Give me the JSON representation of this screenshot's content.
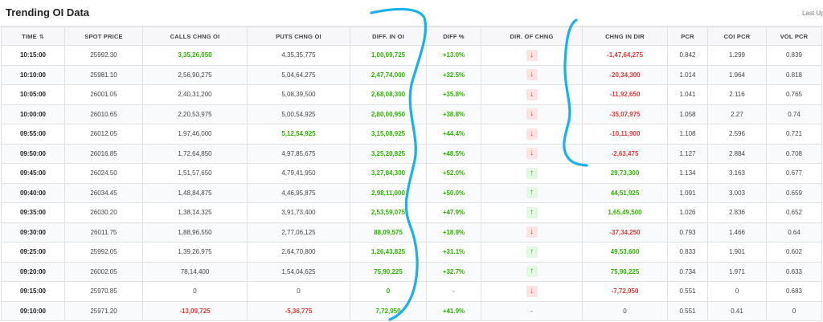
{
  "header": {
    "title": "Trending OI Data",
    "last_updated": "Last Upd"
  },
  "table": {
    "columns": [
      "TIME",
      "SPOT PRICE",
      "CALLS CHNG OI",
      "PUTS CHNG OI",
      "DIFF. IN OI",
      "DIFF %",
      "DIR. OF CHNG",
      "CHNG IN DIR",
      "PCR",
      "COI PCR",
      "VOL PCR"
    ],
    "sort_icon": "⇅",
    "rows": [
      {
        "time": "10:15:00",
        "spot": "25992.30",
        "calls": "3,35,26,050",
        "calls_color": "green",
        "puts": "4,35,35,775",
        "puts_color": "grey",
        "diff": "1,00,09,725",
        "diff_pct": "+13.0%",
        "dir": "down",
        "chng": "-1,47,64,275",
        "chng_color": "red",
        "pcr": "0.842",
        "coi": "1.299",
        "vol": "0.839"
      },
      {
        "time": "10:10:00",
        "spot": "25981.10",
        "calls": "2,56,90,275",
        "calls_color": "grey",
        "puts": "5,04,64,275",
        "puts_color": "grey",
        "diff": "2,47,74,000",
        "diff_pct": "+32.5%",
        "dir": "down",
        "chng": "-20,34,300",
        "chng_color": "red",
        "pcr": "1.014",
        "coi": "1.964",
        "vol": "0.818"
      },
      {
        "time": "10:05:00",
        "spot": "26001.05",
        "calls": "2,40,31,200",
        "calls_color": "grey",
        "puts": "5,08,39,500",
        "puts_color": "grey",
        "diff": "2,68,08,300",
        "diff_pct": "+35.8%",
        "dir": "down",
        "chng": "-11,92,650",
        "chng_color": "red",
        "pcr": "1.041",
        "coi": "2.116",
        "vol": "0.765"
      },
      {
        "time": "10:00:00",
        "spot": "26010.65",
        "calls": "2,20,53,975",
        "calls_color": "grey",
        "puts": "5,00,54,925",
        "puts_color": "grey",
        "diff": "2,80,00,950",
        "diff_pct": "+38.8%",
        "dir": "down",
        "chng": "-35,07,975",
        "chng_color": "red",
        "pcr": "1.058",
        "coi": "2.27",
        "vol": "0.74"
      },
      {
        "time": "09:55:00",
        "spot": "26012.05",
        "calls": "1,97,46,000",
        "calls_color": "grey",
        "puts": "5,12,54,925",
        "puts_color": "green",
        "diff": "3,15,08,925",
        "diff_pct": "+44.4%",
        "dir": "down",
        "chng": "-10,11,900",
        "chng_color": "red",
        "pcr": "1.108",
        "coi": "2.596",
        "vol": "0.721"
      },
      {
        "time": "09:50:00",
        "spot": "26016.85",
        "calls": "1,72,64,850",
        "calls_color": "grey",
        "puts": "4,97,85,675",
        "puts_color": "grey",
        "diff": "3,25,20,825",
        "diff_pct": "+48.5%",
        "dir": "down",
        "chng": "-2,63,475",
        "chng_color": "red",
        "pcr": "1.127",
        "coi": "2.884",
        "vol": "0.708"
      },
      {
        "time": "09:45:00",
        "spot": "26024.50",
        "calls": "1,51,57,650",
        "calls_color": "grey",
        "puts": "4,79,41,950",
        "puts_color": "grey",
        "diff": "3,27,84,300",
        "diff_pct": "+52.0%",
        "dir": "up",
        "chng": "29,73,300",
        "chng_color": "green",
        "pcr": "1.134",
        "coi": "3.163",
        "vol": "0.677"
      },
      {
        "time": "09:40:00",
        "spot": "26034.45",
        "calls": "1,48,84,875",
        "calls_color": "grey",
        "puts": "4,46,95,875",
        "puts_color": "grey",
        "diff": "2,98,11,000",
        "diff_pct": "+50.0%",
        "dir": "up",
        "chng": "44,51,925",
        "chng_color": "green",
        "pcr": "1.091",
        "coi": "3.003",
        "vol": "0.659"
      },
      {
        "time": "09:35:00",
        "spot": "26030.20",
        "calls": "1,38,14,325",
        "calls_color": "grey",
        "puts": "3,91,73,400",
        "puts_color": "grey",
        "diff": "2,53,59,075",
        "diff_pct": "+47.9%",
        "dir": "up",
        "chng": "1,65,49,500",
        "chng_color": "green",
        "pcr": "1.026",
        "coi": "2.836",
        "vol": "0.652"
      },
      {
        "time": "09:30:00",
        "spot": "26011.75",
        "calls": "1,88,96,550",
        "calls_color": "grey",
        "puts": "2,77,06,125",
        "puts_color": "grey",
        "diff": "88,09,575",
        "diff_pct": "+18.9%",
        "dir": "down",
        "chng": "-37,34,250",
        "chng_color": "red",
        "pcr": "0.793",
        "coi": "1.466",
        "vol": "0.64"
      },
      {
        "time": "09:25:00",
        "spot": "25992.05",
        "calls": "1,39,26,975",
        "calls_color": "grey",
        "puts": "2,64,70,800",
        "puts_color": "grey",
        "diff": "1,26,43,825",
        "diff_pct": "+31.1%",
        "dir": "up",
        "chng": "49,53,600",
        "chng_color": "green",
        "pcr": "0.833",
        "coi": "1.901",
        "vol": "0.602"
      },
      {
        "time": "09:20:00",
        "spot": "26002.05",
        "calls": "78,14,400",
        "calls_color": "grey",
        "puts": "1,54,04,625",
        "puts_color": "grey",
        "diff": "75,90,225",
        "diff_pct": "+32.7%",
        "dir": "up",
        "chng": "75,90,225",
        "chng_color": "green",
        "pcr": "0.734",
        "coi": "1.971",
        "vol": "0.633"
      },
      {
        "time": "09:15:00",
        "spot": "25970.85",
        "calls": "0",
        "calls_color": "grey",
        "puts": "0",
        "puts_color": "grey",
        "diff": "0",
        "diff_pct": "-",
        "dir": "down",
        "chng": "-7,72,950",
        "chng_color": "red",
        "pcr": "0.551",
        "coi": "0",
        "vol": "0.683"
      },
      {
        "time": "09:10:00",
        "spot": "25971.20",
        "calls": "-13,09,725",
        "calls_color": "red",
        "puts": "-5,36,775",
        "puts_color": "red",
        "diff": "7,72,950",
        "diff_pct": "+41.9%",
        "dir": "none",
        "chng": "0",
        "chng_color": "grey",
        "pcr": "0.551",
        "coi": "0.41",
        "vol": "0"
      }
    ]
  },
  "arrows": {
    "up": "↑",
    "down": "↓",
    "none": "-"
  },
  "colors": {
    "green": "#2db300",
    "red": "#e03a3a",
    "annotation": "#1ab0e8"
  }
}
